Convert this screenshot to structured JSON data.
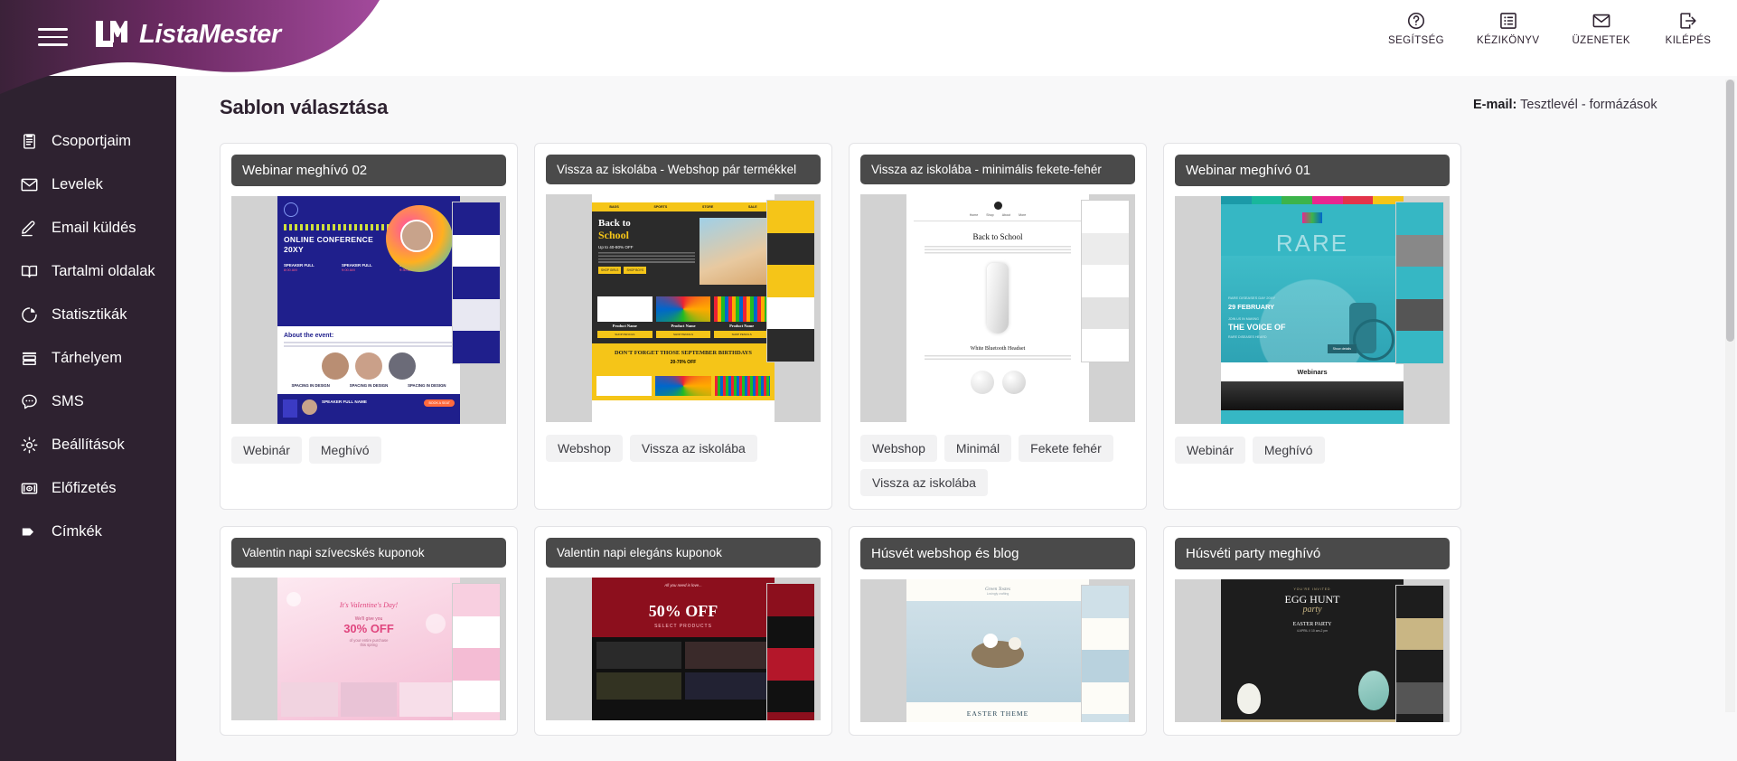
{
  "brand": {
    "name": "ListaMester",
    "logo_icon": "lm-logo-icon",
    "menu_icon": "hamburger-icon"
  },
  "topnav": [
    {
      "label": "SEGÍTSÉG",
      "icon": "question-circle-icon"
    },
    {
      "label": "KÉZIKÖNYV",
      "icon": "list-book-icon"
    },
    {
      "label": "ÜZENETEK",
      "icon": "envelope-icon"
    },
    {
      "label": "KILÉPÉS",
      "icon": "exit-arrow-icon"
    }
  ],
  "sidebar": {
    "items": [
      {
        "label": "Csoportjaim",
        "icon": "clipboard-icon"
      },
      {
        "label": "Levelek",
        "icon": "envelope-icon"
      },
      {
        "label": "Email küldés",
        "icon": "pencil-icon"
      },
      {
        "label": "Tartalmi oldalak",
        "icon": "book-open-icon"
      },
      {
        "label": "Statisztikák",
        "icon": "pie-chart-icon"
      },
      {
        "label": "Tárhelyem",
        "icon": "server-icon"
      },
      {
        "label": "SMS",
        "icon": "chat-bubble-icon"
      },
      {
        "label": "Beállítások",
        "icon": "gear-icon"
      },
      {
        "label": "Előfizetés",
        "icon": "banknote-icon"
      },
      {
        "label": "Címkék",
        "icon": "tag-icon"
      }
    ]
  },
  "main": {
    "page_title": "Sablon választása",
    "email_label": "E-mail:",
    "email_value": "Tesztlevél - formázások"
  },
  "templates": [
    {
      "title": "Webinar meghívó 02",
      "tags": [
        "Webinár",
        "Meghívó"
      ],
      "preview_theme": "conference-blue",
      "preview_text": {
        "headline": "ONLINE CONFERENCE 20XY",
        "section": "About the event:",
        "speaker": "SPEAKER FULL NAME",
        "topic": "SPACING IN DESIGN"
      }
    },
    {
      "title": "Vissza az iskolába - Webshop pár termékkel",
      "tags": [
        "Webshop",
        "Vissza az iskolába"
      ],
      "preview_theme": "back-to-school-yellow",
      "preview_text": {
        "headline": "Back to School",
        "offer": "Up to 40-80% OFF",
        "product": "Product Name",
        "banner": "DON'T FORGET THOSE SEPTEMBER BIRTHDAYS",
        "discount": "20-70% OFF"
      }
    },
    {
      "title": "Vissza az iskolába - minimális fekete-fehér",
      "tags": [
        "Webshop",
        "Minimál",
        "Fekete fehér",
        "Vissza az iskolába"
      ],
      "preview_theme": "minimal-bw",
      "preview_text": {
        "headline": "Back to School",
        "product": "White Bluetooth Headset"
      }
    },
    {
      "title": "Webinar meghívó 01",
      "tags": [
        "Webinár",
        "Meghívó"
      ],
      "preview_theme": "rare-teal",
      "preview_text": {
        "headline": "RARE",
        "date": "29 FEBRUARY",
        "sub": "THE VOICE OF",
        "section": "Webinars"
      }
    },
    {
      "title": "Valentin napi szívecskés kuponok",
      "tags": [],
      "preview_theme": "valentine-pink",
      "preview_text": {
        "headline": "It's Valentine's Day!",
        "offer": "30% OFF"
      }
    },
    {
      "title": "Valentin napi elegáns kuponok",
      "tags": [],
      "preview_theme": "valentine-red",
      "preview_text": {
        "headline": "50% OFF",
        "sub": "SELECT PRODUCTS"
      }
    },
    {
      "title": "Húsvét webshop és blog",
      "tags": [],
      "preview_theme": "easter-blue",
      "preview_text": {
        "headline": "EASTER THEME"
      }
    },
    {
      "title": "Húsvéti party meghívó",
      "tags": [],
      "preview_theme": "easter-dark",
      "preview_text": {
        "headline": "EGG HUNT party",
        "sub": "EASTER PARTY"
      }
    }
  ],
  "colors": {
    "sidebar_bg": "#2e2230",
    "brand_purple": "#8e3a8c",
    "card_title_bg": "#4a4a4a",
    "page_bg": "#f8f8f9"
  }
}
